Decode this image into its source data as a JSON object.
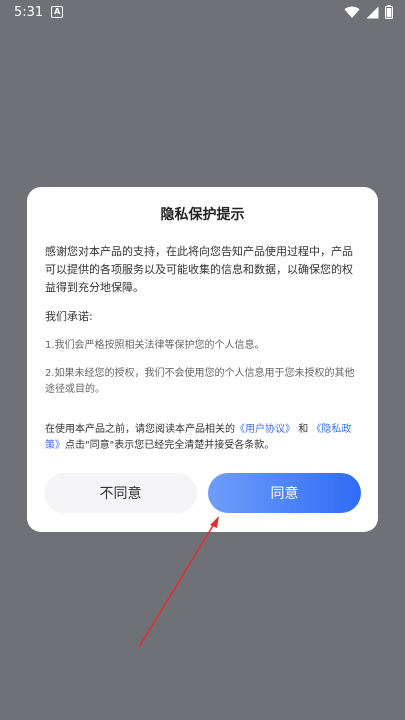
{
  "status_bar": {
    "time": "5:31",
    "icons": [
      "notification-a-icon",
      "wifi-icon",
      "signal-icon",
      "battery-icon"
    ]
  },
  "dialog": {
    "title": "隐私保护提示",
    "intro": "感谢您对本产品的支持，在此将向您告知产品使用过程中，产品可以提供的各项服务以及可能收集的信息和数据，以确保您的权益得到充分地保障。",
    "promise_heading": "我们承诺:",
    "promises": [
      "1.我们会严格按照相关法律等保护您的个人信息。",
      "2.如果未经您的授权，我们不会使用您的个人信息用于您未授权的其他途径或目的。"
    ],
    "agreement": {
      "prefix": "在使用本产品之前，请您阅读本产品相关的",
      "user_agreement_link": "《用户协议》",
      "connector": "和",
      "privacy_policy_link": "《隐私政策》",
      "suffix": "点击\"同意\"表示您已经完全清楚并接受各条款。"
    },
    "disagree_label": "不同意",
    "agree_label": "同意"
  },
  "colors": {
    "overlay": "#6f7177",
    "link": "#3b74ec",
    "agree_gradient_start": "#6f9ef9",
    "agree_gradient_end": "#2f6cf6",
    "annotation_arrow": "#e03030"
  }
}
